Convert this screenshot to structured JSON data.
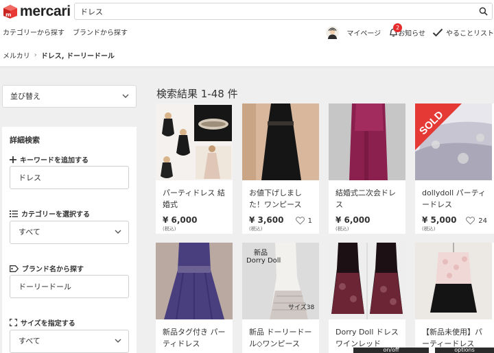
{
  "header": {
    "logo_text": "mercari",
    "search_value": "ドレス",
    "subnav": [
      "カテゴリーから探す",
      "ブランドから探す"
    ],
    "mypage": "マイページ",
    "notifications": "お知らせ",
    "notification_count": "2",
    "todo": "やることリスト"
  },
  "breadcrumb": {
    "home": "メルカリ",
    "current": "ドレス, ドーリードール"
  },
  "sidebar": {
    "sort_label": "並び替え",
    "title": "詳細検索",
    "keyword_label": "キーワードを追加する",
    "keyword_value": "ドレス",
    "category_label": "カテゴリーを選択する",
    "category_value": "すべて",
    "brand_label": "ブランド名から探す",
    "brand_value": "ドーリードール",
    "size_label": "サイズを指定する",
    "size_value": "すべて"
  },
  "results": {
    "title": "検索結果 1-48 件",
    "items": [
      {
        "name": "パーティドレス 結婚式",
        "price": "¥ 6,000",
        "tax": "(税込)",
        "likes": ""
      },
      {
        "name": "お値下げしました！ワンピース",
        "price": "¥ 3,600",
        "tax": "(税込)",
        "likes": "1"
      },
      {
        "name": "結婚式二次会ドレス",
        "price": "¥ 6,000",
        "tax": "(税込)",
        "likes": ""
      },
      {
        "name": "dollydoll パーティードレス",
        "price": "¥ 5,000",
        "tax": "(税込)",
        "likes": "24",
        "sold": "SOLD"
      },
      {
        "name": "新品タグ付き パーティドレス",
        "price": "",
        "tax": "",
        "likes": ""
      },
      {
        "name": "新品 ドーリードール◇ワンピース",
        "price": "",
        "tax": "",
        "likes": "",
        "overlay_top": "新品",
        "overlay_brand": "Dorry Doll",
        "overlay_size": "サイズ38"
      },
      {
        "name": "Dorry Doll ドレス ワインレッド",
        "price": "",
        "tax": "",
        "likes": ""
      },
      {
        "name": "【新品未使用】パーティードレス",
        "price": "",
        "tax": "",
        "likes": ""
      }
    ]
  },
  "bottom_bar": {
    "onoff": "on/off",
    "options": "options"
  }
}
